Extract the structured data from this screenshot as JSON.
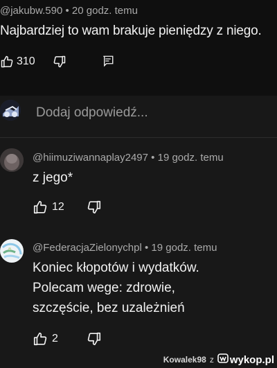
{
  "top_comment": {
    "handle": "@jakubw.590",
    "separator": "•",
    "time": "20 godz. temu",
    "text": "Najbardziej to wam brakuje pieniędzy z niego.",
    "likes": "310",
    "icons": [
      "thumb-up-icon",
      "thumb-down-icon",
      "comment-icon"
    ]
  },
  "reply_box": {
    "placeholder": "Dodaj odpowiedź..."
  },
  "replies": [
    {
      "handle": "@hiimuziwannaplay2497",
      "time": "19 godz. temu",
      "text": "z jego*",
      "likes": "12"
    },
    {
      "handle": "@FederacjaZielonychpl",
      "time": "19 godz. temu",
      "text": "Koniec kłopotów i wydatków. Polecam wege: zdrowie, szczęście, bez uzależnień",
      "likes": "2"
    }
  ],
  "watermark": {
    "user": "Kowalek98",
    "via": "z",
    "site": "wykop.pl"
  },
  "colors": {
    "background": "#181818",
    "highlight_background": "#0f0f0f",
    "text": "#f1f1f1",
    "meta_text": "#aaaaaa"
  }
}
